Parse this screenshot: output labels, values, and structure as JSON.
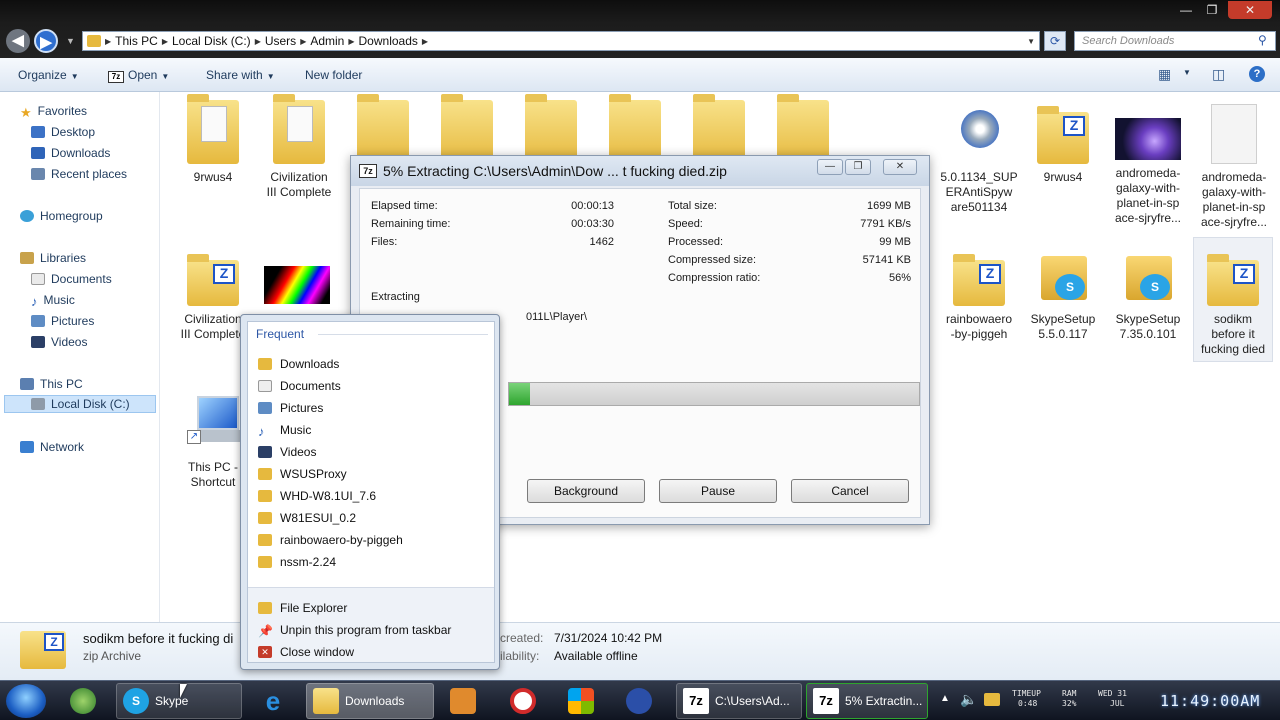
{
  "window": {
    "controls": [
      "—",
      "❐",
      "✕"
    ]
  },
  "address": {
    "crumbs": [
      "This PC",
      "Local Disk (C:)",
      "Users",
      "Admin",
      "Downloads"
    ]
  },
  "search": {
    "placeholder": "Search Downloads"
  },
  "toolbar": {
    "organize": "Organize",
    "open": "Open",
    "share_with": "Share with",
    "new_folder": "New folder"
  },
  "navpane": {
    "favorites": "Favorites",
    "desktop": "Desktop",
    "downloads": "Downloads",
    "recent": "Recent places",
    "homegroup": "Homegroup",
    "libraries": "Libraries",
    "documents": "Documents",
    "music": "Music",
    "pictures": "Pictures",
    "videos": "Videos",
    "this_pc": "This PC",
    "local_disk": "Local Disk (C:)",
    "network": "Network"
  },
  "files": {
    "f1": "9rwus4",
    "f2a": "Civilization",
    "f2b": "III Complete",
    "f_spy1": "5.0.1134_SUP",
    "f_spy2": "ERAntiSpyw",
    "f_spy3": "are501134",
    "f_9rw": "9rwus4",
    "f_and1a": "andromeda-",
    "f_and1b": "galaxy-with-",
    "f_and1c": "planet-in-sp",
    "f_and1d": "ace-sjryfre...",
    "f_and2a": "andromeda-",
    "f_and2b": "galaxy-with-",
    "f_and2c": "planet-in-sp",
    "f_and2d": "ace-sjryfre...",
    "f_civ2a": "Civilization",
    "f_civ2b": "III Complete",
    "f_rb1": "rainbowaero",
    "f_rb2": "-by-piggeh",
    "f_sk1a": "SkypeSetup",
    "f_sk1b": "5.5.0.117",
    "f_sk2a": "SkypeSetup",
    "f_sk2b": "7.35.0.101",
    "f_sod1": "sodikm",
    "f_sod2": "before it",
    "f_sod3": "fucking died",
    "f_pc1": "This PC -",
    "f_pc2": "Shortcut"
  },
  "zip": {
    "title": "5% Extracting C:\\Users\\Admin\\Dow ... t fucking died.zip",
    "elapsed_label": "Elapsed time:",
    "elapsed": "00:00:13",
    "remaining_label": "Remaining time:",
    "remaining": "00:03:30",
    "files_label": "Files:",
    "files": "1462",
    "total_label": "Total size:",
    "total": "1699 MB",
    "speed_label": "Speed:",
    "speed": "7791 KB/s",
    "processed_label": "Processed:",
    "processed": "99 MB",
    "compressed_label": "Compressed size:",
    "compressed": "57141 KB",
    "ratio_label": "Compression ratio:",
    "ratio": "56%",
    "extracting_label": "Extracting",
    "path": "011L\\Player\\",
    "progress": 0.05,
    "btn_background": "Background",
    "btn_pause": "Pause",
    "btn_cancel": "Cancel"
  },
  "jumplist": {
    "frequent": "Frequent",
    "items": [
      "Downloads",
      "Documents",
      "Pictures",
      "Music",
      "Videos",
      "WSUSProxy",
      "WHD-W8.1UI_7.6",
      "W81ESUI_0.2",
      "rainbowaero-by-piggeh",
      "nssm-2.24"
    ],
    "file_explorer": "File Explorer",
    "unpin": "Unpin this program from taskbar",
    "close": "Close window"
  },
  "details": {
    "name": "sodikm before it fucking di",
    "type": "zip Archive",
    "created_label": "created:",
    "created": "7/31/2024 10:42 PM",
    "avail_label": "ilability:",
    "avail": "Available offline"
  },
  "taskbar": {
    "skype": "Skype",
    "downloads": "Downloads",
    "z1": "C:\\Users\\Ad...",
    "z2": "5% Extractin...",
    "tray_timeup": "TIMEUP",
    "tray_timeup_val": "0:48",
    "tray_ram": "RAM",
    "tray_ram_val": "32%",
    "tray_day": "WED 31",
    "tray_month": "JUL",
    "clock": "11:49:00AM"
  },
  "colors": {
    "accent": "#2d57a6",
    "progress": "#2ea52e",
    "taskbar": "#0f1420"
  }
}
